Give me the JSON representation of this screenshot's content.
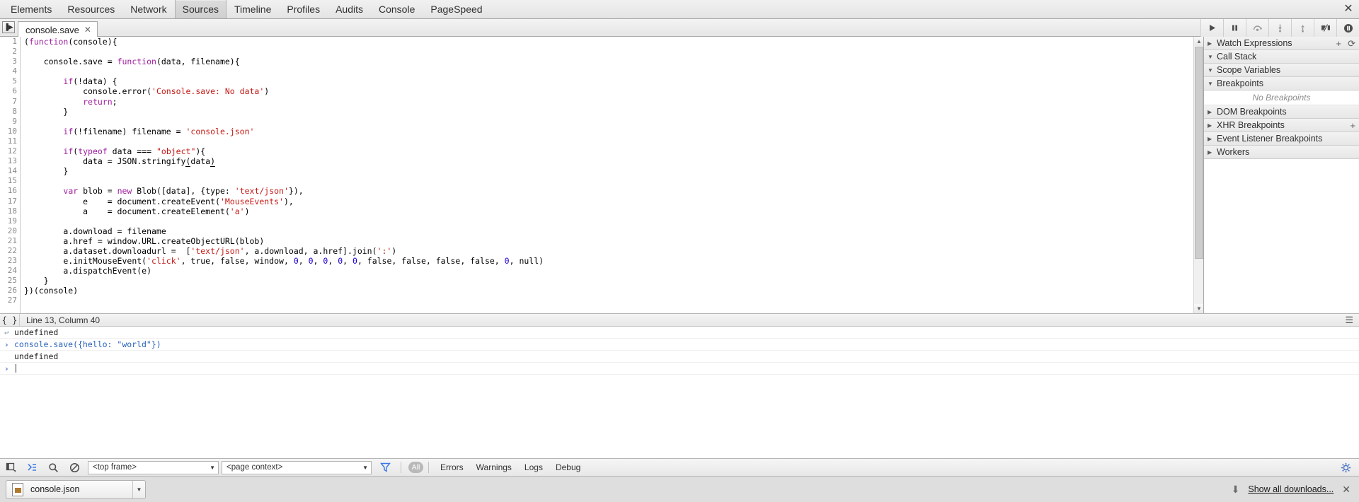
{
  "devtools": {
    "tabs": [
      {
        "label": "Elements",
        "selected": false
      },
      {
        "label": "Resources",
        "selected": false
      },
      {
        "label": "Network",
        "selected": false
      },
      {
        "label": "Sources",
        "selected": true
      },
      {
        "label": "Timeline",
        "selected": false
      },
      {
        "label": "Profiles",
        "selected": false
      },
      {
        "label": "Audits",
        "selected": false
      },
      {
        "label": "Console",
        "selected": false
      },
      {
        "label": "PageSpeed",
        "selected": false
      }
    ],
    "close_label": "✕"
  },
  "file_tab": {
    "name": "console.save",
    "close": "✕"
  },
  "debugger_controls": [
    {
      "name": "resume-script-execution",
      "title": "Resume"
    },
    {
      "name": "pause-script-execution",
      "title": "Pause"
    },
    {
      "name": "step-over-next-function-call",
      "title": "Step over"
    },
    {
      "name": "step-into-next-function-call",
      "title": "Step into"
    },
    {
      "name": "step-out-of-current-function",
      "title": "Step out"
    },
    {
      "name": "deactivate-breakpoints",
      "title": "Deactivate breakpoints"
    },
    {
      "name": "pause-on-exceptions",
      "title": "Pause on exceptions"
    }
  ],
  "editor": {
    "line_numbers": [
      1,
      2,
      3,
      4,
      5,
      6,
      7,
      8,
      9,
      10,
      11,
      12,
      13,
      14,
      15,
      16,
      17,
      18,
      19,
      20,
      21,
      22,
      23,
      24,
      25,
      26,
      27
    ],
    "lines": [
      "(function(console){",
      "",
      "    console.save = function(data, filename){",
      "",
      "        if(!data) {",
      "            console.error('Console.save: No data')",
      "            return;",
      "        }",
      "",
      "        if(!filename) filename = 'console.json'",
      "",
      "        if(typeof data === \"object\"){",
      "            data = JSON.stringify(data)",
      "        }",
      "",
      "        var blob = new Blob([data], {type: 'text/json'}),",
      "            e    = document.createEvent('MouseEvents'),",
      "            a    = document.createElement('a')",
      "",
      "        a.download = filename",
      "        a.href = window.URL.createObjectURL(blob)",
      "        a.dataset.downloadurl =  ['text/json', a.download, a.href].join(':')",
      "        e.initMouseEvent('click', true, false, window, 0, 0, 0, 0, 0, false, false, false, false, 0, null)",
      "        a.dispatchEvent(e)",
      "    }",
      "})(console)",
      ""
    ]
  },
  "debug_panel": {
    "sections": [
      {
        "label": "Watch Expressions",
        "expanded": false,
        "actions": [
          "+",
          "⟳"
        ]
      },
      {
        "label": "Call Stack",
        "expanded": true,
        "actions": []
      },
      {
        "label": "Scope Variables",
        "expanded": true,
        "actions": []
      },
      {
        "label": "Breakpoints",
        "expanded": true,
        "actions": []
      }
    ],
    "breakpoints_empty": "No Breakpoints",
    "sections_lower": [
      {
        "label": "DOM Breakpoints",
        "expanded": false,
        "actions": []
      },
      {
        "label": "XHR Breakpoints",
        "expanded": false,
        "actions": [
          "+"
        ]
      },
      {
        "label": "Event Listener Breakpoints",
        "expanded": false,
        "actions": []
      },
      {
        "label": "Workers",
        "expanded": false,
        "actions": []
      }
    ]
  },
  "status_bar": {
    "pretty_print": "{ }",
    "location": "Line 13, Column 40"
  },
  "console": {
    "rows": [
      {
        "mark": "↩",
        "text": "undefined",
        "kind": "output"
      },
      {
        "mark": "›",
        "text": "console.save({hello: \"world\"})",
        "kind": "input"
      },
      {
        "mark": "",
        "text": "undefined",
        "kind": "output"
      },
      {
        "mark": "›",
        "text": "",
        "kind": "prompt"
      }
    ]
  },
  "console_toolbar": {
    "icons": [
      "dock-side-icon",
      "show-console-icon",
      "search-icon",
      "clear-console-icon"
    ],
    "frame_select": {
      "value": "<top frame>"
    },
    "context_select": {
      "value": "<page context>"
    },
    "filter_icon": "filter-icon",
    "all_badge": "All",
    "levels": [
      "Errors",
      "Warnings",
      "Logs",
      "Debug"
    ],
    "settings_icon": "gear-icon"
  },
  "download_shelf": {
    "file_name": "console.json",
    "dropdown_icon": "chevron-down-icon",
    "download_icon": "download-arrow-icon",
    "show_all_label": "Show all downloads...",
    "close_label": "✕"
  },
  "colors": {
    "keyword": "#a020a0",
    "string": "#c41a16",
    "number": "#1c00cf",
    "console_input": "#2a63b8",
    "filter_blue": "#3b78e7"
  }
}
